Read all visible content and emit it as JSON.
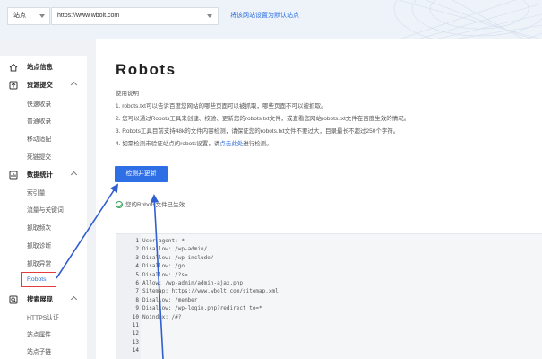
{
  "topbar": {
    "site_select": "站点",
    "url_value": "https://www.wbolt.com",
    "set_default_link": "将该网站设置为默认站点"
  },
  "sidebar": {
    "groups": [
      {
        "label": "站点信息",
        "icon": "home-icon"
      },
      {
        "label": "资源提交",
        "icon": "upload-icon"
      },
      {
        "label": "数据统计",
        "icon": "stats-icon"
      },
      {
        "label": "搜索展现",
        "icon": "search-display-icon"
      }
    ],
    "submit_items": [
      "快速收录",
      "普通收录",
      "移动适配",
      "死链提交"
    ],
    "stats_items": [
      "索引量",
      "流量与关键词",
      "抓取频次",
      "抓取诊断",
      "抓取异常",
      "Robots"
    ],
    "search_items": [
      "HTTPS认证",
      "站点属性",
      "站点子链"
    ],
    "active_item": "Robots"
  },
  "main": {
    "title": "Robots",
    "desc_head": "使用说明",
    "desc_lines": [
      "1. robots.txt可以告诉百度您网站的哪些页面可以被抓取，哪些页面不可以被抓取。",
      "2. 您可以通过Robots工具来创建、校验、更新您的robots.txt文件，或查看您网站robots.txt文件在百度生效的情况。",
      "3. Robots工具目前支持48k的文件内容检测，请保证您的robots.txt文件不要过大，目录最长不超过250个字符。"
    ],
    "desc_line4_pre": "4. 如需检测未验证站点的robots设置，请",
    "desc_line4_link": "点击此处",
    "desc_line4_post": "进行检测。",
    "check_button": "检测并更新",
    "status_text": "您的Robots文件已生效"
  },
  "editor": {
    "line_numbers": [
      "1",
      "2",
      "3",
      "4",
      "5",
      "6",
      "7",
      "8",
      "9",
      "10",
      "11",
      "12",
      "13",
      "14"
    ],
    "lines": [
      "User-agent: *",
      "Disallow: /wp-admin/",
      "Disallow: /wp-include/",
      "Disallow: /go",
      "Disallow: /?s=",
      "Allow: /wp-admin/admin-ajax.php",
      "Sitemap: https://www.wbolt.com/sitemap.xml",
      "Disallow: /member",
      "Disallow: /wp-login.php?redirect_to=*",
      "Noindex: /#?",
      "",
      "",
      "",
      ""
    ]
  },
  "colors": {
    "accent": "#2f6fe6",
    "highlight_box": "#e23c3c",
    "success": "#3aa35c"
  }
}
